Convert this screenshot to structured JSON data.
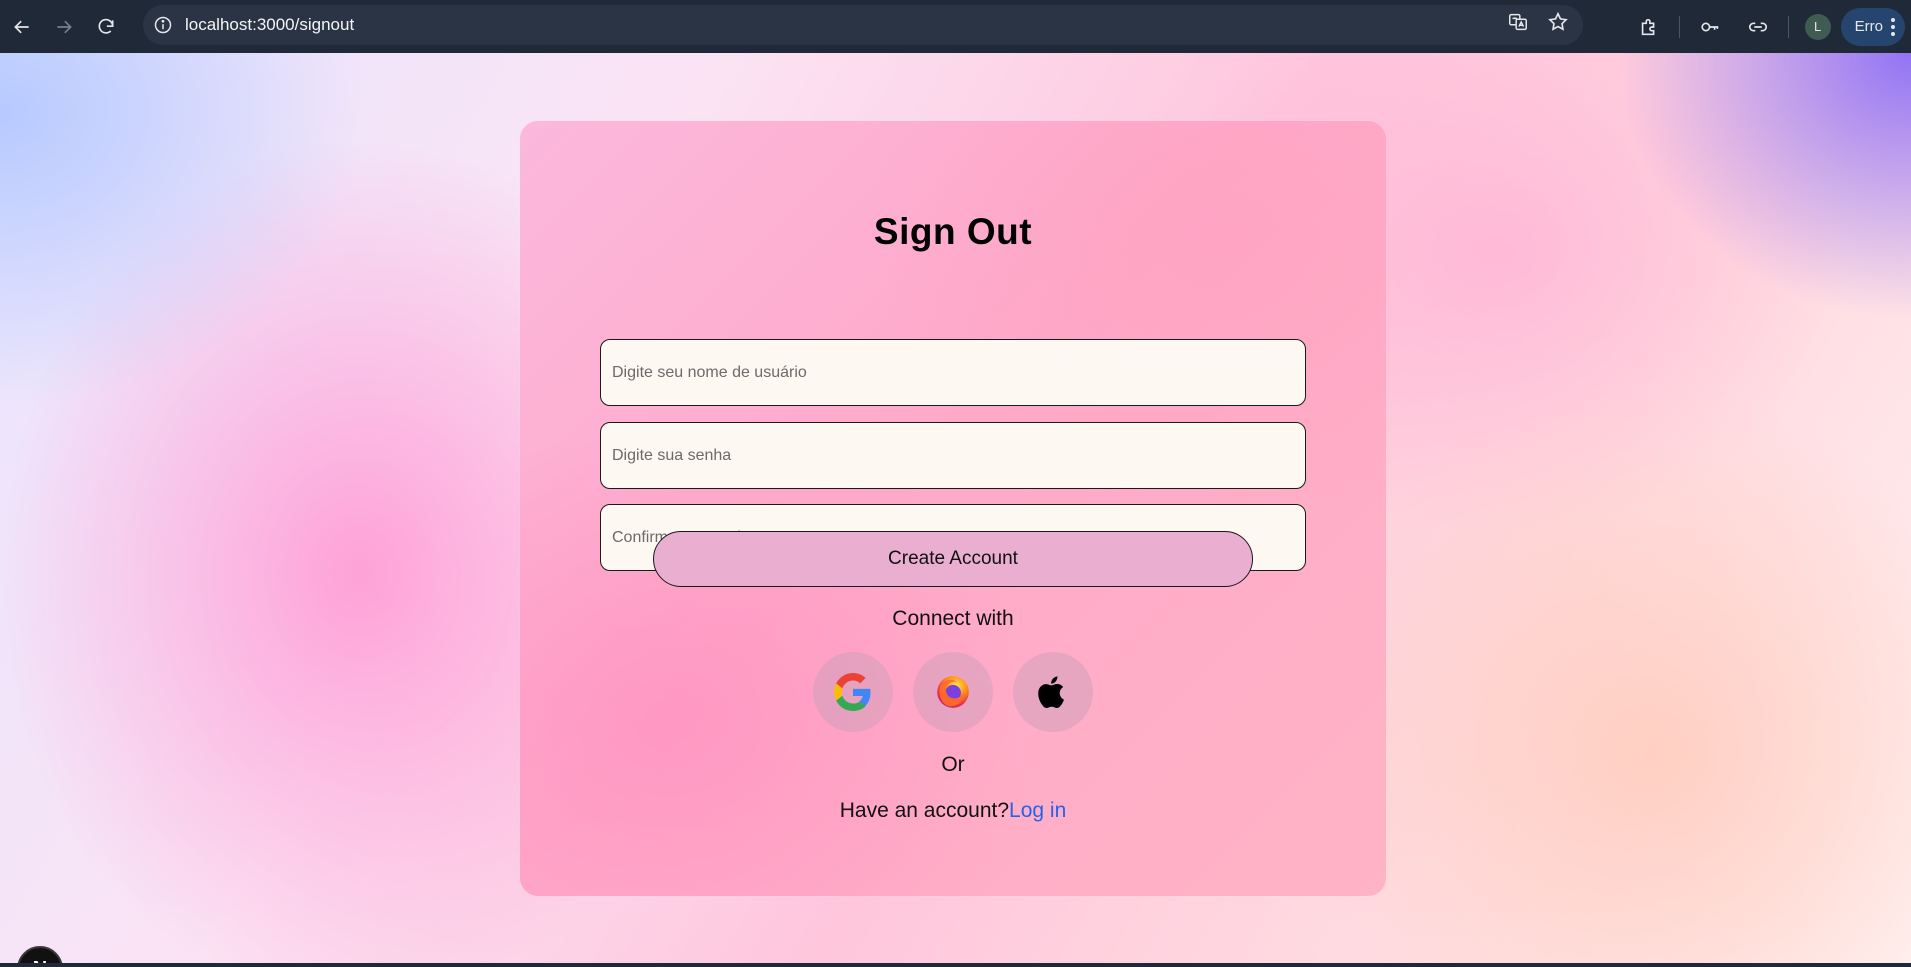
{
  "browser": {
    "url": "localhost:3000/signout",
    "avatar_letter": "L",
    "profile_label": "Erro"
  },
  "form": {
    "title": "Sign Out",
    "username_placeholder": "Digite seu nome de usuário",
    "password_placeholder": "Digite sua senha",
    "confirm_placeholder": "Confirme sua senha",
    "create_button": "Create Account",
    "connect_text": "Connect with",
    "social": [
      {
        "name": "google",
        "icon": "google-icon"
      },
      {
        "name": "firefox",
        "icon": "firefox-icon"
      },
      {
        "name": "apple",
        "icon": "apple-icon"
      }
    ],
    "or_text": "Or",
    "have_account_text": "Have an account?",
    "login_link": "Log in"
  },
  "dev_badge": {
    "letter": "N"
  },
  "colors": {
    "chrome_bg": "#1f2937",
    "card_pink": "#ffa9c9",
    "button_bg": "#eaaed0",
    "link_blue": "#2563eb"
  }
}
